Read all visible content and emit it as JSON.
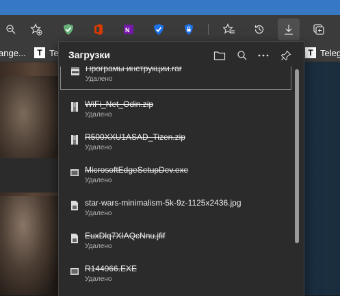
{
  "favorites": [
    {
      "label": "ange..."
    },
    {
      "tile": "T",
      "label": "Te"
    },
    {
      "tile": "T",
      "label": "Teleg"
    }
  ],
  "downloads": {
    "title": "Загрузки",
    "items": [
      {
        "name": "Програмы инструкции.rar",
        "status": "Удалено",
        "icon": "archive-icon"
      },
      {
        "name": "WiFi_Net_Odin.zip",
        "status": "Удалено",
        "icon": "zip-icon"
      },
      {
        "name": "R500XXU1ASAD_Tizen.zip",
        "status": "Удалено",
        "icon": "zip-icon"
      },
      {
        "name": "MicrosoftEdgeSetupDev.exe",
        "status": "Удалено",
        "icon": "exe-icon"
      },
      {
        "name": "star-wars-minimalism-5k-9z-1125x2436.jpg",
        "status": "Удалено",
        "icon": "file-icon"
      },
      {
        "name": "EuxDlq7XIAQcNnu.jfif",
        "status": "Удалено",
        "icon": "file-icon"
      },
      {
        "name": "R144966.EXE",
        "status": "Удалено",
        "icon": "exe-icon"
      }
    ]
  },
  "colors": {
    "accent_blue": "#3778c4",
    "flyout_bg": "#2b2b2b",
    "toolbar_bg": "#3b3b3b"
  }
}
